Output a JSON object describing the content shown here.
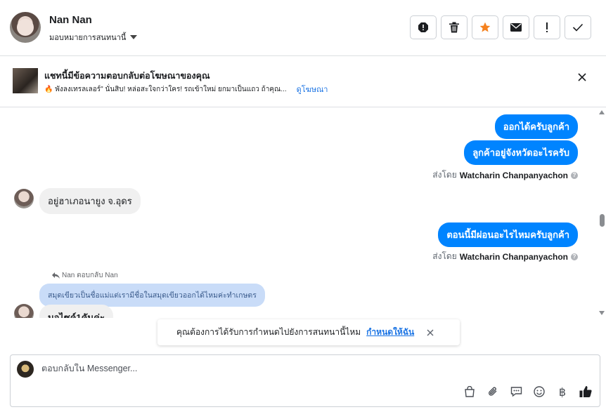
{
  "header": {
    "user_name": "Nan Nan",
    "assign_label": "มอบหมายการสนทนานี้",
    "actions": [
      "spam-icon",
      "trash-icon",
      "star-icon",
      "envelope-icon",
      "exclamation-icon",
      "check-icon"
    ]
  },
  "banner": {
    "title": "แชทนี้มีข้อความตอบกลับต่อโฆษณาของคุณ",
    "body": "🔥 พังลงเทรลเลอร์\" นั่นสิบ! หล่อสะใจกว่าใคร! รถเข้าใหม่ ยกมาเป็นแถว ถ้าคุณ...",
    "link": "ดูโฆษณา"
  },
  "messages": [
    {
      "from": "agent",
      "text": "ออกได้ครับลูกค้า"
    },
    {
      "from": "agent",
      "text": "ลูกค้าอยู่จังหวัดอะไรครับ"
    },
    {
      "sent_by_prefix": "ส่งโดย",
      "sent_by_name": "Watcharin Chanpanyachon"
    },
    {
      "from": "customer",
      "text": "อยู่ฮาเภอนายูง จ.อุดร"
    },
    {
      "from": "agent",
      "text": "ตอนนี้มีผ่อนอะไรไหมครับลูกค้า"
    },
    {
      "sent_by_prefix": "ส่งโดย",
      "sent_by_name": "Watcharin Chanpanyachon"
    },
    {
      "reply_label": "Nan ตอบกลับ Nan",
      "quoted": "สมุดเขียวเป็นชื่อแม่แต่เรามีชื่อในสมุดเขียวออกได้ไหมค่ะทำเกษตร",
      "from": "customer",
      "text": "มอไซค์1คันค่ะ"
    }
  ],
  "toast": {
    "text": "คุณต้องการได้รับการกำหนดไปยังการสนทนานี้ไหม",
    "link": "กำหนดให้ฉัน"
  },
  "composer": {
    "placeholder": "ตอบกลับใน Messenger...",
    "tools": [
      "shopping-bag-icon",
      "attachment-icon",
      "saved-reply-icon",
      "emoji-icon",
      "baht-icon",
      "thumbs-up-icon"
    ],
    "baht_symbol": "฿"
  },
  "colors": {
    "accent": "#0084ff",
    "star": "#f5821f",
    "link": "#1b74e4",
    "quote_bg": "#c9dcf8"
  }
}
